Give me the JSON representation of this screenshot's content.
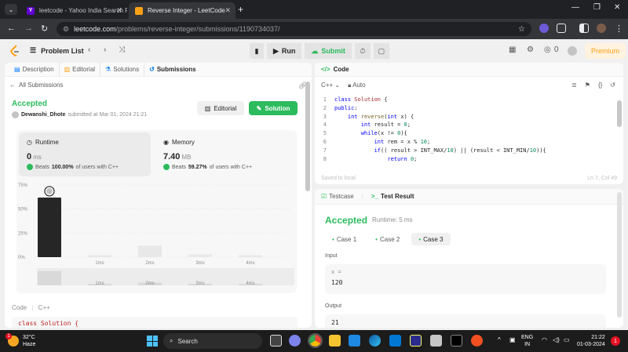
{
  "browser": {
    "tabs": [
      {
        "title": "leetcode - Yahoo India Search R",
        "active": false
      },
      {
        "title": "Reverse Integer - LeetCode",
        "active": true
      }
    ],
    "url_host": "leetcode.com",
    "url_path": "/problems/reverse-integer/submissions/1190734037/"
  },
  "nav": {
    "problem_list": "Problem List",
    "run": "Run",
    "submit": "Submit",
    "streak_count": "0",
    "premium": "Premium"
  },
  "left": {
    "tabs": [
      "Description",
      "Editorial",
      "Solutions",
      "Submissions"
    ],
    "all_submissions": "All Submissions",
    "status": "Accepted",
    "user": "Dewanshi_Dhote",
    "submitted_at": "submitted at Mar 01, 2024 21:21",
    "editorial_button": "Editorial",
    "solution_button": "Solution",
    "runtime": {
      "label": "Runtime",
      "value": "0",
      "unit": "ms",
      "beats_prefix": "Beats",
      "beats_value": "100.00%",
      "beats_suffix": "of users with C++"
    },
    "memory": {
      "label": "Memory",
      "value": "7.40",
      "unit": "MB",
      "beats_prefix": "Beats",
      "beats_value": "59.27%",
      "beats_suffix": "of users with C++"
    },
    "code_label": "Code",
    "code_lang": "C++",
    "code_preview": "class Solution {"
  },
  "chart_data": {
    "type": "bar",
    "categories": [
      "0ms",
      "1ms",
      "2ms",
      "3ms",
      "4ms"
    ],
    "x_tick_labels": [
      "",
      "1ms",
      "2ms",
      "3ms",
      "4ms"
    ],
    "values": [
      62,
      2,
      12,
      3,
      2
    ],
    "y_ticks": [
      "75%",
      "50%",
      "25%",
      "0%"
    ],
    "ylim": [
      0,
      75
    ],
    "highlight_index": 0,
    "colors": {
      "highlight": "#262626",
      "bar": "#e8e8e8",
      "grid": "#e5e5e5"
    }
  },
  "editor": {
    "title": "Code",
    "lang": "C++",
    "mode": "Auto",
    "saved": "Saved to local",
    "cursor": "Ln 7, Col 49",
    "lines": [
      {
        "n": "1",
        "indent": "",
        "parts": [
          [
            "kw",
            "class"
          ],
          [
            "txt",
            " "
          ],
          [
            "ty",
            "Solution"
          ],
          [
            "txt",
            " {"
          ]
        ]
      },
      {
        "n": "2",
        "indent": "",
        "parts": [
          [
            "kw",
            "public"
          ],
          [
            "txt",
            ":"
          ]
        ]
      },
      {
        "n": "3",
        "indent": "    ",
        "parts": [
          [
            "kw",
            "int"
          ],
          [
            "txt",
            " "
          ],
          [
            "fn",
            "reverse"
          ],
          [
            "txt",
            "("
          ],
          [
            "kw",
            "int"
          ],
          [
            "txt",
            " x) {"
          ]
        ]
      },
      {
        "n": "4",
        "indent": "        ",
        "parts": [
          [
            "kw",
            "int"
          ],
          [
            "txt",
            " result = "
          ],
          [
            "num",
            "0"
          ],
          [
            "txt",
            ";"
          ]
        ]
      },
      {
        "n": "5",
        "indent": "        ",
        "parts": [
          [
            "kw",
            "while"
          ],
          [
            "txt",
            "(x != "
          ],
          [
            "num",
            "0"
          ],
          [
            "txt",
            "){"
          ]
        ]
      },
      {
        "n": "6",
        "indent": "            ",
        "parts": [
          [
            "kw",
            "int"
          ],
          [
            "txt",
            " rem = x % "
          ],
          [
            "num",
            "10"
          ],
          [
            "txt",
            ";"
          ]
        ]
      },
      {
        "n": "7",
        "indent": "            ",
        "parts": [
          [
            "kw",
            "if"
          ],
          [
            "txt",
            "(( result > INT_MAX/"
          ],
          [
            "num",
            "10"
          ],
          [
            "txt",
            ") || (result < INT_MIN/"
          ],
          [
            "num",
            "10"
          ],
          [
            "txt",
            ")){"
          ]
        ]
      },
      {
        "n": "8",
        "indent": "                ",
        "parts": [
          [
            "kw",
            "return"
          ],
          [
            "txt",
            " "
          ],
          [
            "num",
            "0"
          ],
          [
            "txt",
            ";"
          ]
        ]
      }
    ]
  },
  "result": {
    "tabs": [
      "Testcase",
      "Test Result"
    ],
    "status": "Accepted",
    "runtime": "Runtime: 5 ms",
    "cases": [
      "Case 1",
      "Case 2",
      "Case 3"
    ],
    "input_label": "Input",
    "input_var": "x =",
    "input_value": "120",
    "output_label": "Output",
    "output_value": "21"
  },
  "taskbar": {
    "temp": "32°C",
    "weather": "Haze",
    "weather_badge": "1",
    "search": "Search",
    "lang_top": "ENG",
    "lang_bottom": "IN",
    "time": "21:22",
    "date": "01-03-2024",
    "notif_count": "1"
  }
}
